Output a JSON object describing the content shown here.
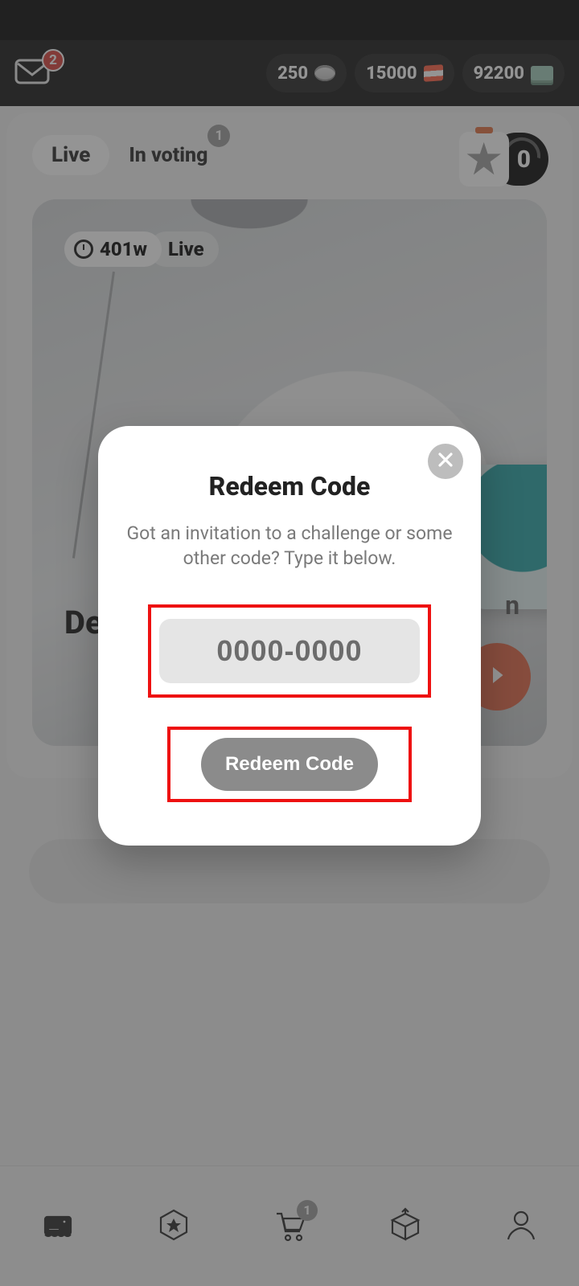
{
  "header": {
    "mail_badge": "2",
    "currencies": [
      {
        "value": "250",
        "icon": "coin"
      },
      {
        "value": "15000",
        "icon": "book"
      },
      {
        "value": "92200",
        "icon": "cash"
      }
    ]
  },
  "tabs": {
    "live_label": "Live",
    "voting_label": "In voting",
    "voting_badge": "1"
  },
  "star_counter": {
    "count": "0"
  },
  "card": {
    "time": "401w",
    "status": "Live",
    "title_visible": "Des"
  },
  "side_letter": "n",
  "modal": {
    "title": "Redeem Code",
    "subtitle": "Got an invitation to a challenge or some other code? Type it below.",
    "input_placeholder": "0000-0000",
    "button_label": "Redeem Code"
  },
  "nav": {
    "cart_badge": "1"
  },
  "colors": {
    "highlight": "#e11",
    "accent": "#e0613e"
  }
}
